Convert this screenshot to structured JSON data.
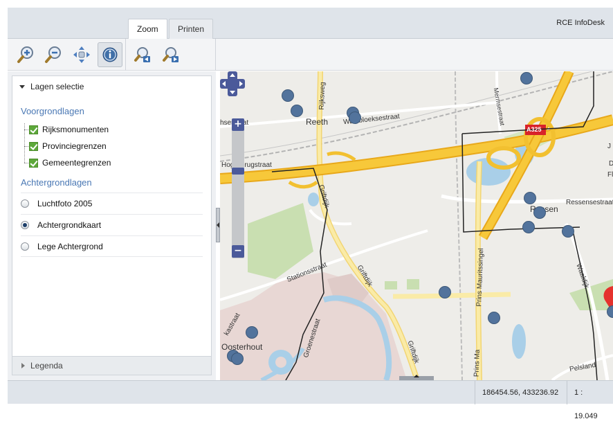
{
  "header": {
    "tabs": [
      {
        "label": "Zoom",
        "active": true
      },
      {
        "label": "Printen",
        "active": false
      }
    ],
    "title": "RCE InfoDesk"
  },
  "toolbar": {
    "tools": [
      {
        "name": "zoom-in-icon"
      },
      {
        "name": "zoom-out-icon"
      },
      {
        "name": "pan-icon"
      },
      {
        "name": "info-icon",
        "active": true
      },
      {
        "name": "zoom-previous-icon"
      },
      {
        "name": "zoom-next-icon"
      }
    ]
  },
  "layers_panel": {
    "title": "Lagen selectie",
    "foreground_title": "Voorgrondlagen",
    "foreground_layers": [
      {
        "label": "Rijksmonumenten",
        "checked": true
      },
      {
        "label": "Provinciegrenzen",
        "checked": true
      },
      {
        "label": "Gemeentegrenzen",
        "checked": true
      }
    ],
    "background_title": "Achtergrondlagen",
    "background_layers": [
      {
        "label": "Luchtfoto 2005",
        "selected": false
      },
      {
        "label": "Achtergrondkaart",
        "selected": true
      },
      {
        "label": "Lege Achtergrond",
        "selected": false
      }
    ],
    "legend_label": "Legenda"
  },
  "map": {
    "labels": {
      "reeth": "Reeth",
      "ressen": "Ressen",
      "oosterhout": "Oosterhout",
      "rijksweg": "Rijksweg",
      "griftdijk_1": "Griftdijk",
      "griftdijk_2": "Griftdijk",
      "griftdijk_3": "Griftdijk",
      "waalbloeksestraat": "Waalbloeksestraat",
      "hoge_brugstraat": "Hoge Brugstraat",
      "stationsstraat": "Stationsstraat",
      "prins_mauritssingel": "Prins Mauritssingel",
      "prins_ma": "Prins Ma",
      "merm": "Mermsestraat",
      "ressensestraat": "Ressensestraat",
      "waaldijk": "Waaldijk",
      "hsestraat": "hsestraat",
      "road_a325": "A325",
      "kastraat": "kastraat",
      "groenestraat": "Groenestraat",
      "pelsland": "Pelsland",
      "fl": "Fl",
      "d": "D",
      "j": "J"
    }
  },
  "status": {
    "coordinates": "186454.56, 433236.92",
    "scale": "1 : 19.049"
  }
}
